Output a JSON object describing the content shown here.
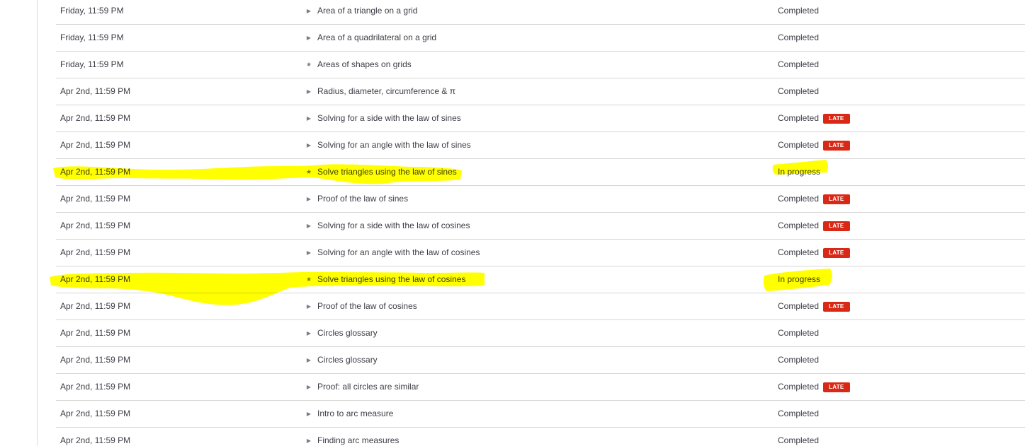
{
  "colors": {
    "late_badge": "#d92916",
    "highlighter": "#ffff00"
  },
  "assignments": [
    {
      "due": "Friday, 11:59 PM",
      "icon": "play-icon",
      "title": "Area of a triangle on a grid",
      "status": "Completed",
      "late": ""
    },
    {
      "due": "Friday, 11:59 PM",
      "icon": "play-icon",
      "title": "Area of a quadrilateral on a grid",
      "status": "Completed",
      "late": ""
    },
    {
      "due": "Friday, 11:59 PM",
      "icon": "star-icon",
      "title": "Areas of shapes on grids",
      "status": "Completed",
      "late": ""
    },
    {
      "due": "Apr 2nd, 11:59 PM",
      "icon": "play-icon",
      "title": "Radius, diameter, circumference & π",
      "status": "Completed",
      "late": ""
    },
    {
      "due": "Apr 2nd, 11:59 PM",
      "icon": "play-icon",
      "title": "Solving for a side with the law of sines",
      "status": "Completed",
      "late": "LATE"
    },
    {
      "due": "Apr 2nd, 11:59 PM",
      "icon": "play-icon",
      "title": "Solving for an angle with the law of sines",
      "status": "Completed",
      "late": "LATE"
    },
    {
      "due": "Apr 2nd, 11:59 PM",
      "icon": "star-icon",
      "title": "Solve triangles using the law of sines",
      "status": "In progress",
      "late": ""
    },
    {
      "due": "Apr 2nd, 11:59 PM",
      "icon": "play-icon",
      "title": "Proof of the law of sines",
      "status": "Completed",
      "late": "LATE"
    },
    {
      "due": "Apr 2nd, 11:59 PM",
      "icon": "play-icon",
      "title": "Solving for a side with the law of cosines",
      "status": "Completed",
      "late": "LATE"
    },
    {
      "due": "Apr 2nd, 11:59 PM",
      "icon": "play-icon",
      "title": "Solving for an angle with the law of cosines",
      "status": "Completed",
      "late": "LATE"
    },
    {
      "due": "Apr 2nd, 11:59 PM",
      "icon": "star-icon",
      "title": "Solve triangles using the law of cosines",
      "status": "In progress",
      "late": ""
    },
    {
      "due": "Apr 2nd, 11:59 PM",
      "icon": "play-icon",
      "title": "Proof of the law of cosines",
      "status": "Completed",
      "late": "LATE"
    },
    {
      "due": "Apr 2nd, 11:59 PM",
      "icon": "play-icon",
      "title": "Circles glossary",
      "status": "Completed",
      "late": ""
    },
    {
      "due": "Apr 2nd, 11:59 PM",
      "icon": "play-icon",
      "title": "Circles glossary",
      "status": "Completed",
      "late": ""
    },
    {
      "due": "Apr 2nd, 11:59 PM",
      "icon": "play-icon",
      "title": "Proof: all circles are similar",
      "status": "Completed",
      "late": "LATE"
    },
    {
      "due": "Apr 2nd, 11:59 PM",
      "icon": "play-icon",
      "title": "Intro to arc measure",
      "status": "Completed",
      "late": ""
    },
    {
      "due": "Apr 2nd, 11:59 PM",
      "icon": "play-icon",
      "title": "Finding arc measures",
      "status": "Completed",
      "late": ""
    }
  ]
}
